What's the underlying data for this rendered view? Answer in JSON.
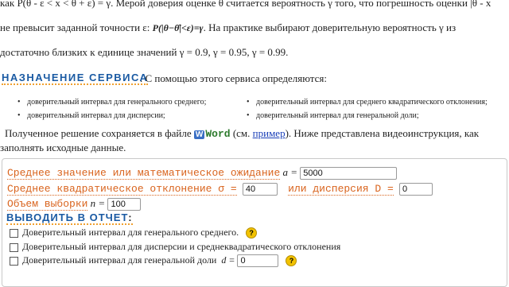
{
  "text": {
    "line1": "как P(θ - ε < x < θ + ε) = γ. Мерой доверия оценке θ считается вероятность γ того, что погрешность оценки |θ - x",
    "line2_start": "не превысит заданной точности ε:",
    "formula": "P(|θ−θ̂|<ε)=γ",
    "line2_end": ". На практике выбирают доверительную вероятность γ из",
    "line3": "достаточно близких к единице значений γ = 0.9, γ = 0.95, γ = 0.99.",
    "heading": "НАЗНАЧЕНИЕ СЕРВИСА",
    "heading_after": ". С помощью этого сервиса определяются:",
    "bullets": [
      "доверительный интервал для генерального среднего;",
      "доверительный интервал для среднего квадратического отклонения;",
      "доверительный интервал для дисперсии;",
      "доверительный интервал для генеральной доли;"
    ],
    "result_before": "Полученное решение сохраняется в файле",
    "word_badge": "W",
    "word_text": "Word",
    "result_mid": "(см.",
    "result_link": "пример",
    "result_after": "). Ниже представлена видеоинструкция, как",
    "result_line2": "заполнять исходные данные."
  },
  "form": {
    "mean_label": "Среднее значение или математическое ожидание",
    "mean_var": "a =",
    "mean_value": "5000",
    "sd_label": "Среднее квадратическое отклонение σ =",
    "sd_value": "40",
    "var_label": "или дисперсия D =",
    "var_value": "0",
    "n_label": "Объем выборки",
    "n_var": "n =",
    "n_value": "100",
    "report_heading": "ВЫВОДИТЬ В ОТЧЕТ",
    "report_colon": ":",
    "options": [
      "Доверительный интервал для генерального среднего.",
      "Доверительный интервал для дисперсии и среднеквадратического отклонения",
      "Доверительный интервал для генеральной доли"
    ],
    "share_var": "d =",
    "share_value": "0",
    "help_glyph": "?"
  },
  "colors": {
    "heading": "#1a5aa3",
    "label": "#d9641e",
    "underline": "#f0a030",
    "help_icon": "#f2c200",
    "link": "#1a3fb8"
  }
}
